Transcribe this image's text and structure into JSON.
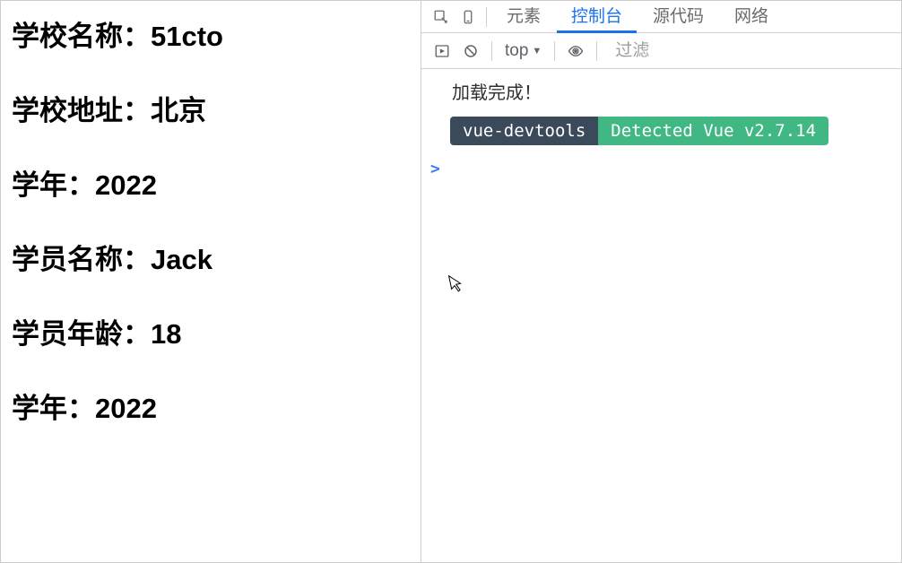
{
  "page": {
    "rows": [
      {
        "label": "学校名称：",
        "value": "51cto"
      },
      {
        "label": "学校地址：",
        "value": "北京"
      },
      {
        "label": "学年：",
        "value": "2022"
      },
      {
        "label": "学员名称：",
        "value": "Jack"
      },
      {
        "label": "学员年龄：",
        "value": "18"
      },
      {
        "label": "学年：",
        "value": "2022"
      }
    ]
  },
  "devtools": {
    "tabs": {
      "elements": "元素",
      "console": "控制台",
      "sources": "源代码",
      "network": "网络"
    },
    "toolbar": {
      "scope_label": "top",
      "filter_placeholder": "过滤"
    },
    "console": {
      "log_message": "加载完成！",
      "badge_left": "vue-devtools",
      "badge_right": "Detected Vue v2.7.14",
      "prompt": ">"
    }
  }
}
